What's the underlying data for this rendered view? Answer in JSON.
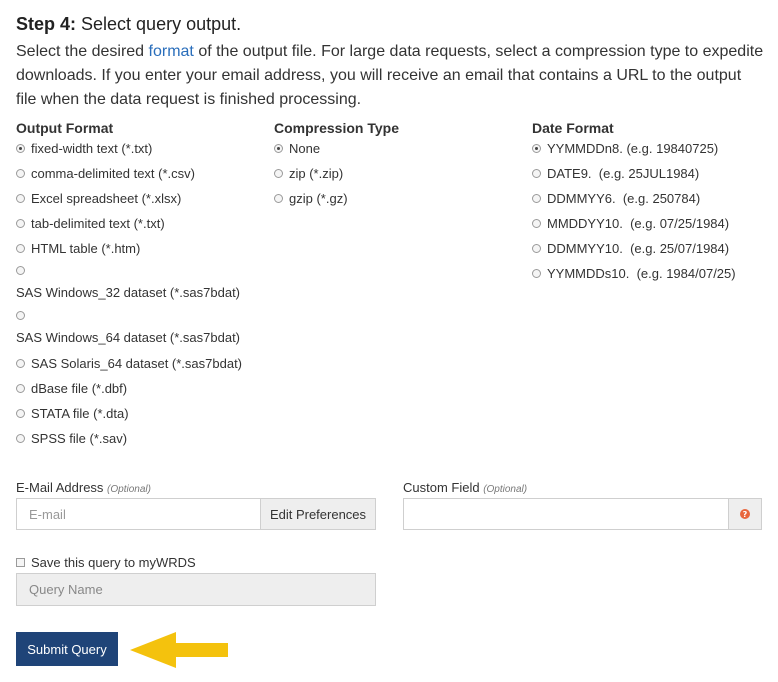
{
  "step": {
    "title_bold": "Step 4:",
    "title_rest": " Select query output.",
    "desc_pre": "Select the desired ",
    "desc_link": "format",
    "desc_post": " of the output file. For large data requests, select a compression type to expedite downloads. If you enter your email address, you will receive an email that contains a URL to the output file when the data request is finished processing."
  },
  "output_format": {
    "heading": "Output Format",
    "options": [
      "fixed-width text (*.txt)",
      "comma-delimited text (*.csv)",
      "Excel spreadsheet (*.xlsx)",
      "tab-delimited text (*.txt)",
      "HTML table (*.htm)",
      "SAS Windows_32 dataset (*.sas7bdat)",
      "SAS Windows_64 dataset (*.sas7bdat)",
      "SAS Solaris_64 dataset (*.sas7bdat)",
      "dBase file (*.dbf)",
      "STATA file (*.dta)",
      "SPSS file (*.sav)"
    ],
    "selected": "fixed-width text (*.txt)"
  },
  "compression": {
    "heading": "Compression Type",
    "options": [
      "None",
      "zip (*.zip)",
      "gzip (*.gz)"
    ],
    "selected": "None"
  },
  "date_format": {
    "heading": "Date Format",
    "options": [
      "YYMMDDn8. (e.g. 19840725)",
      "DATE9.  (e.g. 25JUL1984)",
      "DDMMYY6.  (e.g. 250784)",
      "MMDDYY10.  (e.g. 07/25/1984)",
      "DDMMYY10.  (e.g. 25/07/1984)",
      "YYMMDDs10.  (e.g. 1984/07/25)"
    ],
    "selected": "YYMMDDn8. (e.g. 19840725)"
  },
  "email": {
    "label": "E-Mail Address",
    "optional": "(Optional)",
    "placeholder": "E-mail",
    "button": "Edit Preferences"
  },
  "custom_field": {
    "label": "Custom Field",
    "optional": "(Optional)",
    "help_glyph": "?"
  },
  "save_query": {
    "label": "Save this query to myWRDS",
    "checked": false,
    "placeholder": "Query Name"
  },
  "submit_label": "Submit Query",
  "colors": {
    "link": "#2a6ebb",
    "submit_bg": "#1f4478",
    "arrow": "#f4c20d",
    "help_icon": "#e8663d"
  },
  "icons": {
    "arrow": "left-arrow-icon",
    "help": "question-circle-icon"
  }
}
